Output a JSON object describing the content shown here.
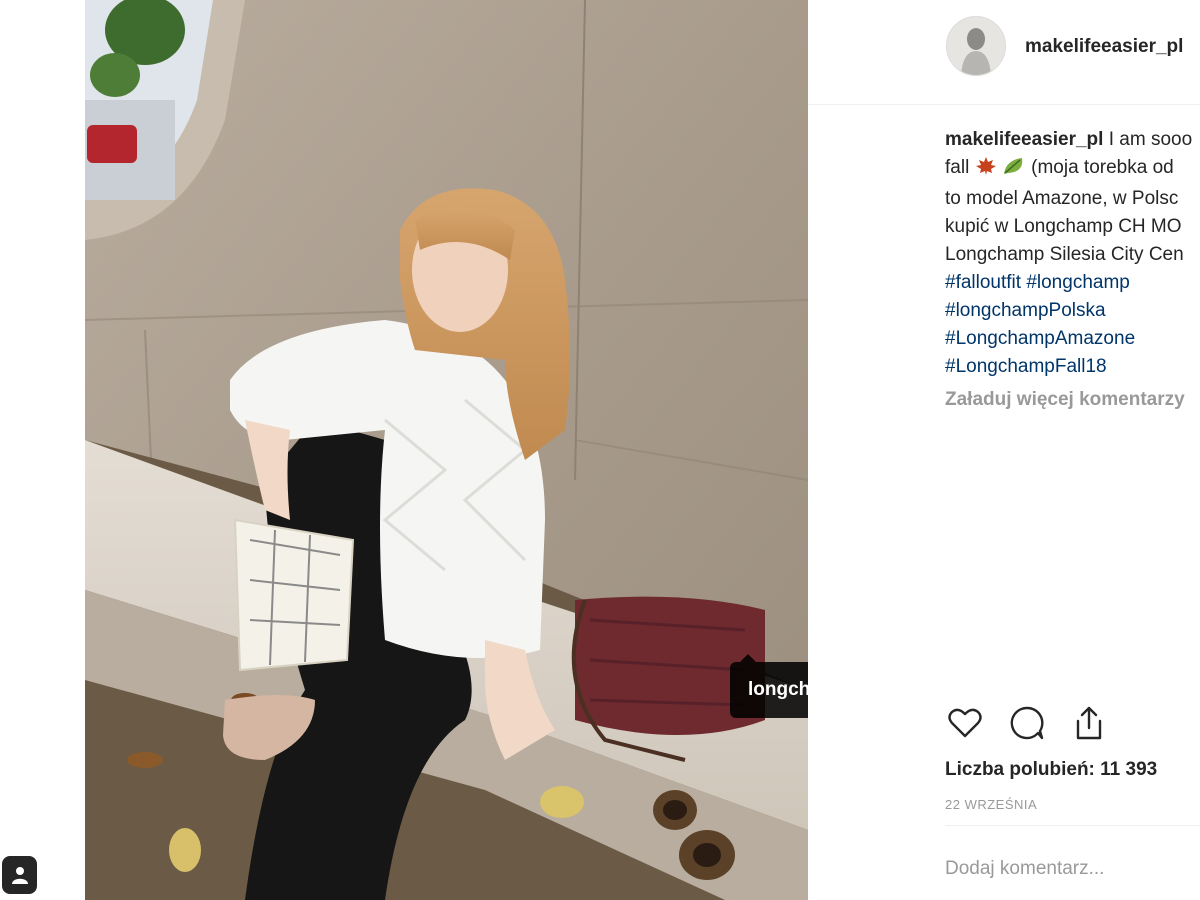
{
  "post": {
    "username": "makelifeeasier_pl",
    "caption_user": "makelifeeasier_pl",
    "caption_lines": [
      " I am sooo",
      "fall",
      " (moja torebka od",
      "to model Amazone, w Polsc",
      "kupić w Longchamp CH MO",
      "Longchamp Silesia City Cen"
    ],
    "hashtags": [
      "#falloutfit #longchamp",
      "#longchampPolska",
      "#LongchampAmazone",
      "#LongchampFall18"
    ],
    "load_more": "Załaduj więcej komentarzy",
    "likes": "Liczba polubień: 11 393",
    "date": "22 WRZEŚNIA",
    "comment_placeholder": "Dodaj komentarz..."
  },
  "photo": {
    "tag_label": "longchamp"
  },
  "icons": {
    "like": "heart-icon",
    "comment": "comment-icon",
    "share": "share-icon",
    "tagged": "tagged-user-icon",
    "emoji_1": "maple-leaf-emoji",
    "emoji_2": "leaf-emoji"
  },
  "colors": {
    "text": "#262626",
    "muted": "#999999",
    "hashtag": "#003569",
    "tag_bubble": "#000000"
  }
}
